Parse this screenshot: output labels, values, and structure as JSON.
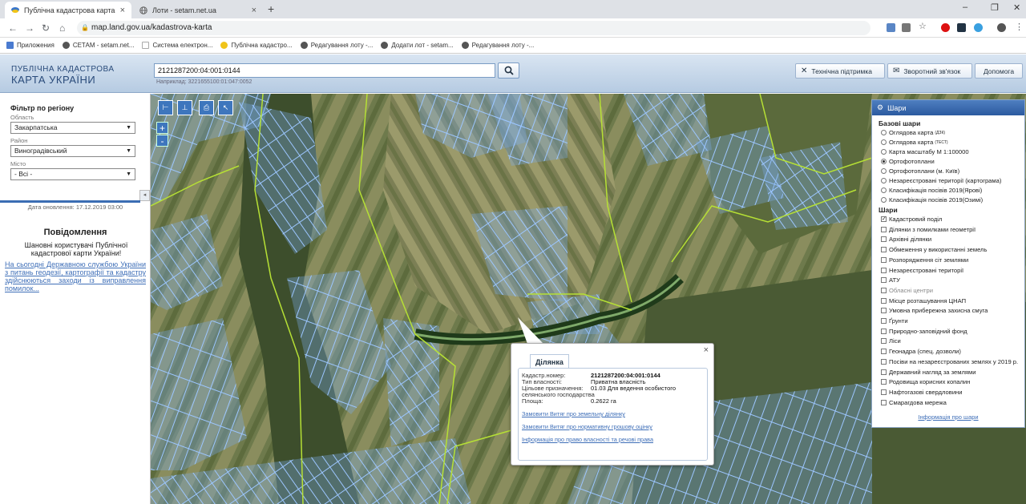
{
  "browser": {
    "tabs": [
      {
        "title": "Публічна кадастрова карта Укр",
        "close": "×"
      },
      {
        "title": "Лоти - setam.net.ua",
        "close": "×"
      }
    ],
    "new_tab": "+",
    "window_controls": {
      "minimize": "–",
      "maximize": "❐",
      "close": "✕"
    },
    "url": "map.land.gov.ua/kadastrova-karta",
    "bookmarks": [
      "Приложения",
      "СЕТАМ - setam.net...",
      "Система електрон...",
      "Публічна кадастро...",
      "Редагування лоту -...",
      "Додати лот - setam...",
      "Редагування лоту -..."
    ]
  },
  "header": {
    "logo_line1": "ПУБЛІЧНА КАДАСТРОВА",
    "logo_line2": "КАРТА УКРАЇНИ",
    "search_value": "2121287200:04:001:0144",
    "search_hint": "Наприклад: 3221655100:01:047:0052",
    "buttons": {
      "support": "Технічна підтримка",
      "feedback": "Зворотний зв'язок",
      "help": "Допомога"
    }
  },
  "sidebar": {
    "filter_title": "Фільтр по регіону",
    "oblast_label": "Область",
    "oblast_value": "Закарпатська",
    "rayon_label": "Район",
    "rayon_value": "Виноградівський",
    "misto_label": "Місто",
    "misto_value": "- Всі -",
    "collapse": "◂",
    "updated": "Дата оновлення: 17.12.2019 03:00",
    "message_title": "Повідомлення",
    "message_greeting": "Шановні користувачі Публічної кадастрової карти України!",
    "message_link": "На сьогодні Державною службою України з питань геодезії, картографії та кадастру здійснюються заходи із виправлення помилок..."
  },
  "map_toolbar": {
    "zoom_in": "+",
    "zoom_out": "-"
  },
  "layers": {
    "title": "Шари",
    "base_title": "Базові шари",
    "base": [
      {
        "label": "Оглядова карта",
        "sup": "(ДЗК)",
        "selected": false
      },
      {
        "label": "Оглядова карта",
        "sup": "(ТЕСТ)",
        "selected": false
      },
      {
        "label": "Карта масштабу М 1:100000",
        "sup": "",
        "selected": false
      },
      {
        "label": "Ортофотоплани",
        "sup": "",
        "selected": true
      },
      {
        "label": "Ортофотоплани (м. Київ)",
        "sup": "",
        "selected": false
      },
      {
        "label": "Незареєстровані території (картограма)",
        "sup": "",
        "selected": false
      },
      {
        "label": "Класифікація посівів 2019(Ярові)",
        "sup": "",
        "selected": false
      },
      {
        "label": "Класифікація посівів 2019(Озимі)",
        "sup": "",
        "selected": false
      }
    ],
    "layers_title": "Шари",
    "overlays": [
      {
        "label": "Кадастровий поділ",
        "checked": true,
        "dim": false
      },
      {
        "label": "Ділянки з помилками геометрії",
        "checked": false,
        "dim": false
      },
      {
        "label": "Архівні ділянки",
        "checked": false,
        "dim": false
      },
      {
        "label": "Обмеження у використанні земель",
        "checked": false,
        "dim": false
      },
      {
        "label": "Розпорядження сіт землями",
        "checked": false,
        "dim": false
      },
      {
        "label": "Незареєстровані території",
        "checked": false,
        "dim": false
      },
      {
        "label": "АТУ",
        "checked": false,
        "dim": false
      },
      {
        "label": "Обласні центри",
        "checked": false,
        "dim": true
      },
      {
        "label": "Місце розташування ЦНАП",
        "checked": false,
        "dim": false
      },
      {
        "label": "Умовна прибережна захисна смуга",
        "checked": false,
        "dim": false
      },
      {
        "label": "Ґрунти",
        "checked": false,
        "dim": false
      },
      {
        "label": "Природно-заповідний фонд",
        "checked": false,
        "dim": false
      },
      {
        "label": "Ліси",
        "checked": false,
        "dim": false
      },
      {
        "label": "Геонадра (спец. дозволи)",
        "checked": false,
        "dim": false
      },
      {
        "label": "Посіви на незареєстрованих землях у 2019 р.",
        "checked": false,
        "dim": false
      },
      {
        "label": "Державний нагляд за землями",
        "checked": false,
        "dim": false
      },
      {
        "label": "Родовища корисних копалин",
        "checked": false,
        "dim": false
      },
      {
        "label": "Нафтогазові свердловини",
        "checked": false,
        "dim": false
      },
      {
        "label": "Смарагдова мережа",
        "checked": false,
        "dim": false
      }
    ],
    "info_link": "Інформація про шари"
  },
  "popup": {
    "tab": "Ділянка",
    "close": "×",
    "fields": [
      {
        "key": "Кадастр.номер:",
        "value": "2121287200:04:001:0144",
        "bold": true
      },
      {
        "key": "Тип власності:",
        "value": "Приватна власність",
        "bold": false
      },
      {
        "key": "Цільове призначення:",
        "value": "01.03 Для ведення особистого",
        "bold": false
      },
      {
        "key": "",
        "value": "",
        "bold": false
      },
      {
        "key": "Площа:",
        "value": "0.2622 га",
        "bold": false
      }
    ],
    "purpose_cont": "селянського господарства",
    "links": [
      "Замовити Витяг про земельну ділянку",
      "Замовити Витяг про нормативну грошову оцінку",
      "Інформація про право власності та речові права"
    ]
  }
}
